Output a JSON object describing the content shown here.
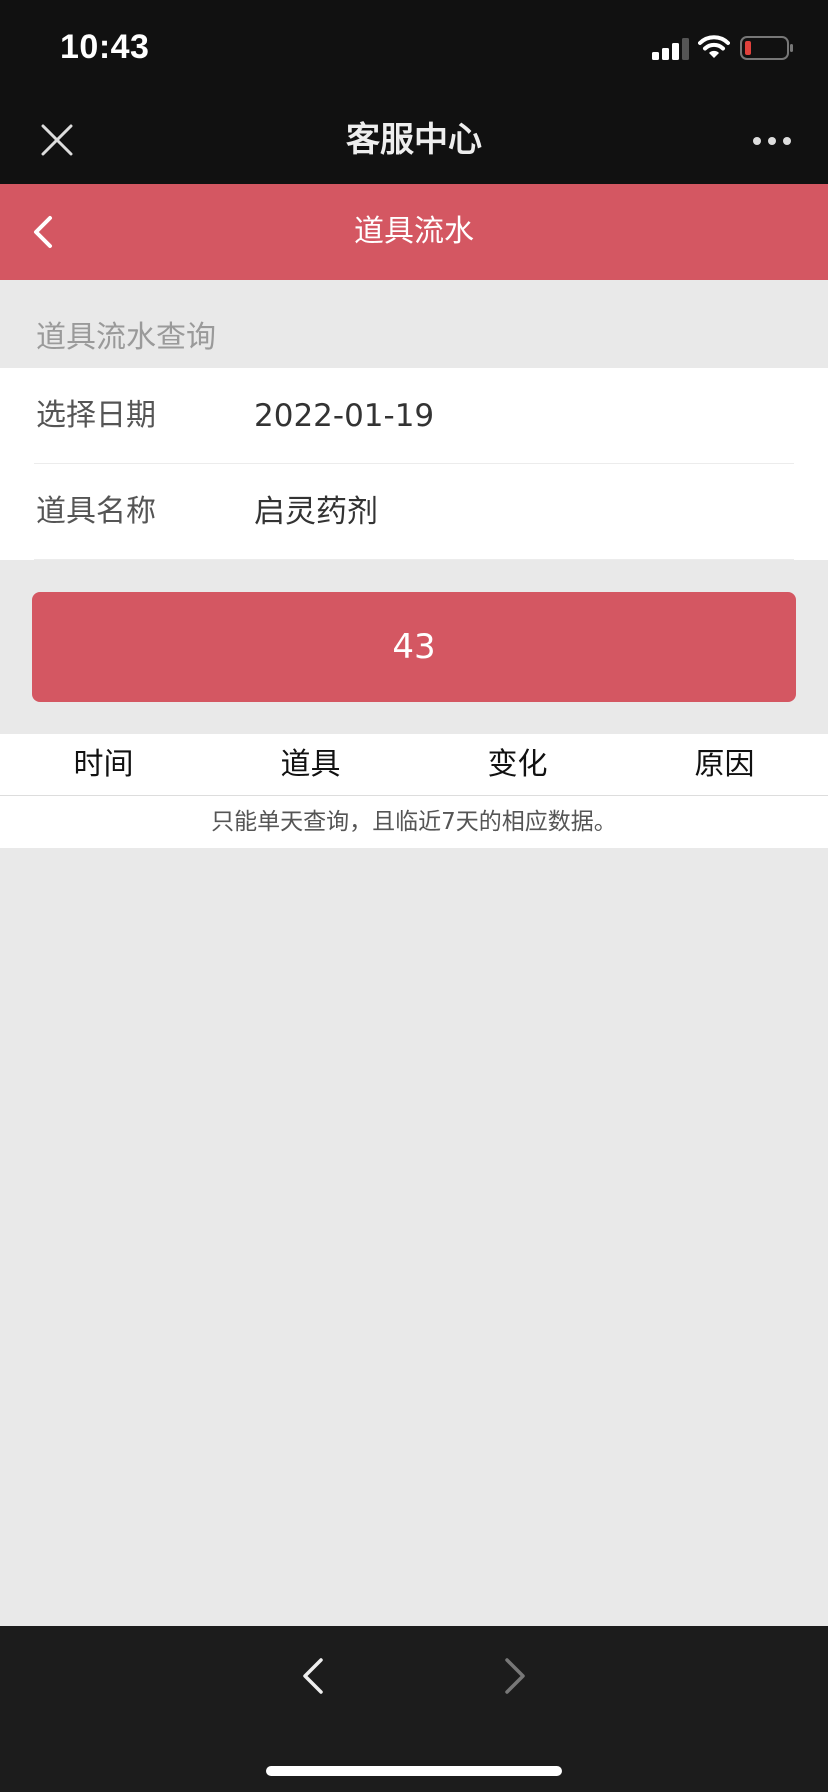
{
  "status_bar": {
    "time": "10:43",
    "icons": [
      "signal-icon",
      "wifi-icon",
      "battery-low-icon"
    ]
  },
  "nav": {
    "title": "客服中心",
    "close_icon": "close-icon",
    "more_icon": "more-dots-icon"
  },
  "header": {
    "title": "道具流水",
    "back_icon": "chevron-left-icon"
  },
  "section_label": "道具流水查询",
  "form": {
    "date_label": "选择日期",
    "date_value": "2022-01-19",
    "item_label": "道具名称",
    "item_value": "启灵药剂"
  },
  "query_button": {
    "label": "43"
  },
  "table": {
    "columns": [
      "时间",
      "道具",
      "变化",
      "原因"
    ],
    "note": "只能单天查询，且临近7天的相应数据。"
  },
  "toolbar": {
    "back_icon": "chevron-left-icon",
    "forward_icon": "chevron-right-icon"
  },
  "colors": {
    "accent": "#d45762",
    "dark_bar": "#111111",
    "background": "#e9e9e9",
    "battery_low": "#e0413c"
  }
}
